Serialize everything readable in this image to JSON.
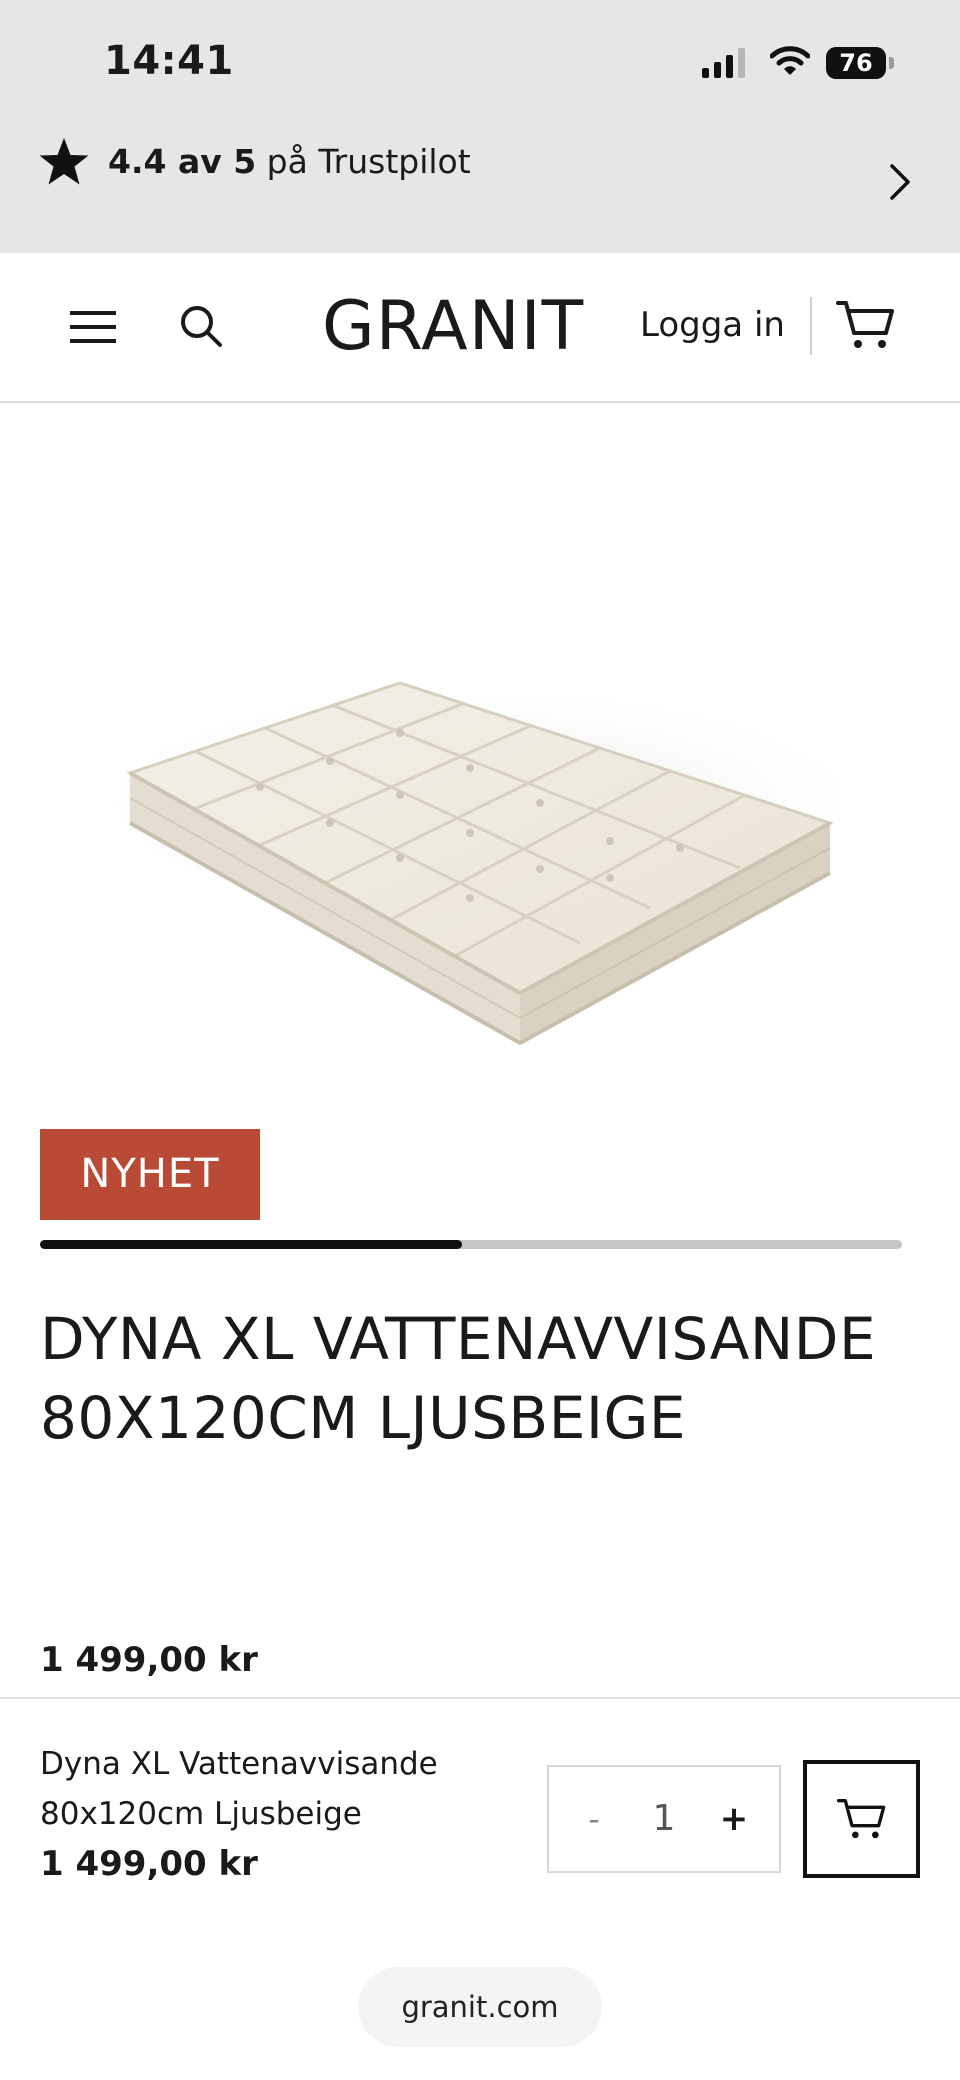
{
  "status_bar": {
    "time": "14:41",
    "battery": "76"
  },
  "trust_banner": {
    "rating": "4.4 av 5",
    "suffix": " på Trustpilot"
  },
  "header": {
    "logo": "GRANIT",
    "login_label": "Logga in"
  },
  "product": {
    "badge": "NYHET",
    "title": "DYNA XL VATTENAVVISANDE 80X120CM LJUSBEIGE",
    "price": "1 499,00 kr",
    "gallery_progress": 0.49,
    "image_description": "cream tufted floor cushion"
  },
  "sticky_cart": {
    "name": "Dyna XL Vattenavvisande 80x120cm Ljusbeige",
    "price": "1 499,00 kr",
    "minus_label": "-",
    "quantity": "1",
    "plus_label": "+"
  },
  "browser": {
    "url": "granit.com"
  },
  "colors": {
    "badge": "#b94a36",
    "top_banner": "#e6e6e6",
    "text": "#1a1a1a"
  },
  "icons": [
    "star-icon",
    "chevron-right-icon",
    "menu-icon",
    "search-icon",
    "cart-icon",
    "signal-icon",
    "wifi-icon"
  ]
}
